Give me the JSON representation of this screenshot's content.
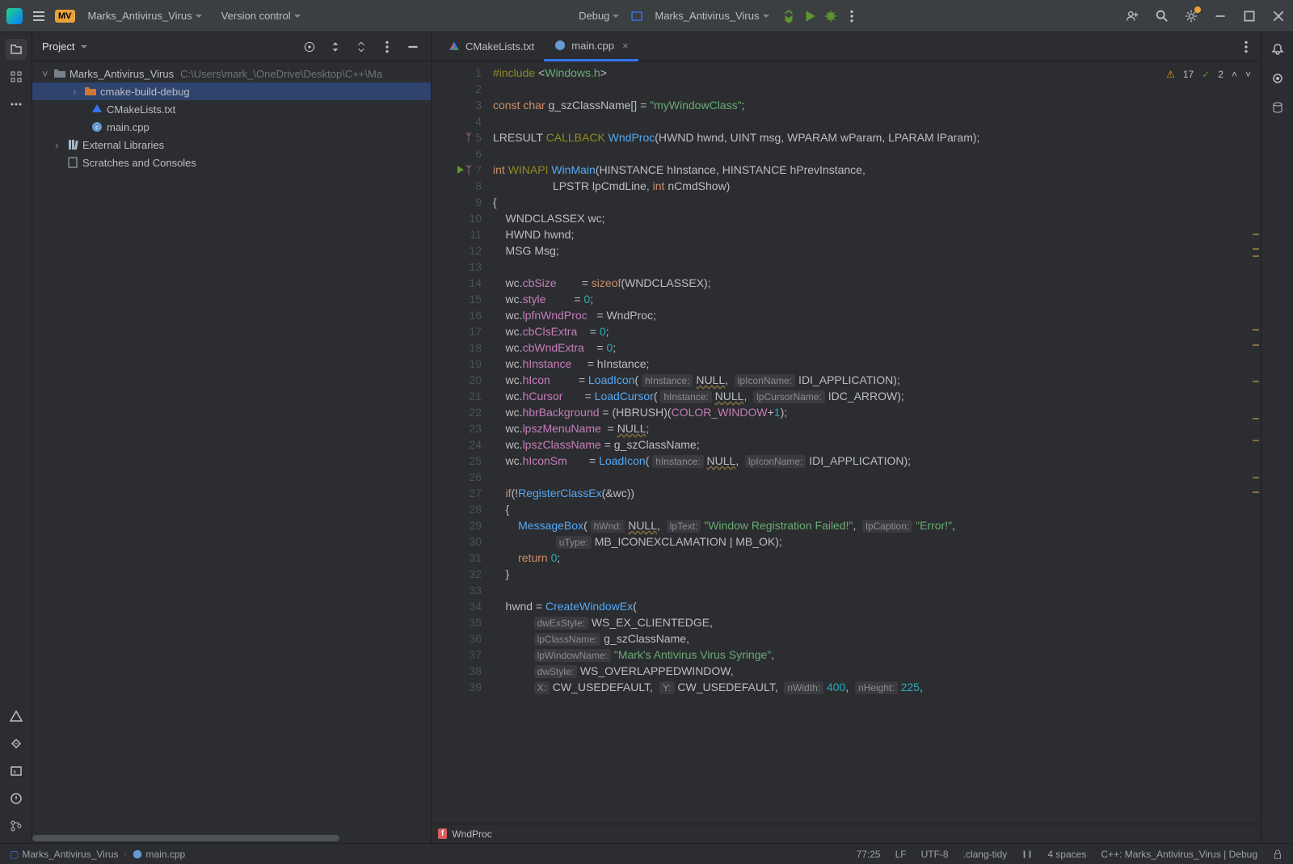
{
  "titlebar": {
    "project_name": "Marks_Antivirus_Virus",
    "project_badge": "MV",
    "vcs": "Version control",
    "run_config": "Debug",
    "target": "Marks_Antivirus_Virus"
  },
  "project_panel": {
    "title": "Project",
    "root": "Marks_Antivirus_Virus",
    "root_path": "C:\\Users\\mark_\\OneDrive\\Desktop\\C++\\Ma",
    "items": [
      {
        "label": "cmake-build-debug",
        "type": "folder"
      },
      {
        "label": "CMakeLists.txt",
        "type": "cmake"
      },
      {
        "label": "main.cpp",
        "type": "cpp"
      }
    ],
    "external": "External Libraries",
    "scratches": "Scratches and Consoles"
  },
  "tabs": [
    {
      "label": "CMakeLists.txt"
    },
    {
      "label": "main.cpp",
      "active": true
    }
  ],
  "inspections": {
    "warnings": "17",
    "weak": "2"
  },
  "breadcrumb": {
    "fn": "WndProc"
  },
  "navbar": {
    "root": "Marks_Antivirus_Virus",
    "file": "main.cpp"
  },
  "status": {
    "pos": "77:25",
    "eol": "LF",
    "enc": "UTF-8",
    "tool": ".clang-tidy",
    "indent": "4 spaces",
    "context": "C++: Marks_Antivirus_Virus | Debug"
  },
  "code_lines": [
    {
      "n": 1,
      "tokens": [
        [
          "macro",
          "#include "
        ],
        [
          "plain",
          "<"
        ],
        [
          "str",
          "Windows.h"
        ],
        [
          "plain",
          ">"
        ]
      ]
    },
    {
      "n": 2,
      "tokens": []
    },
    {
      "n": 3,
      "tokens": [
        [
          "kw",
          "const "
        ],
        [
          "kw",
          "char "
        ],
        [
          "plain",
          "g_szClassName[] = "
        ],
        [
          "str",
          "\"myWindowClass\""
        ],
        [
          "plain",
          ";"
        ]
      ]
    },
    {
      "n": 4,
      "tokens": []
    },
    {
      "n": 5,
      "tokens": [
        [
          "plain",
          "LRESULT "
        ],
        [
          "macro",
          "CALLBACK "
        ],
        [
          "fn",
          "WndProc"
        ],
        [
          "plain",
          "(HWND hwnd, UINT msg, WPARAM wParam, LPARAM lParam);"
        ]
      ]
    },
    {
      "n": 6,
      "tokens": []
    },
    {
      "n": 7,
      "tokens": [
        [
          "kw",
          "int "
        ],
        [
          "macro",
          "WINAPI "
        ],
        [
          "fn",
          "WinMain"
        ],
        [
          "plain",
          "(HINSTANCE hInstance, HINSTANCE hPrevInstance,"
        ]
      ]
    },
    {
      "n": 8,
      "tokens": [
        [
          "plain",
          "                   LPSTR lpCmdLine, "
        ],
        [
          "kw",
          "int "
        ],
        [
          "plain",
          "nCmdShow)"
        ]
      ]
    },
    {
      "n": 9,
      "tokens": [
        [
          "plain",
          "{"
        ]
      ]
    },
    {
      "n": 10,
      "tokens": [
        [
          "plain",
          "    WNDCLASSEX wc;"
        ]
      ]
    },
    {
      "n": 11,
      "tokens": [
        [
          "plain",
          "    HWND hwnd;"
        ]
      ]
    },
    {
      "n": 12,
      "tokens": [
        [
          "plain",
          "    MSG Msg;"
        ]
      ]
    },
    {
      "n": 13,
      "tokens": []
    },
    {
      "n": 14,
      "tokens": [
        [
          "plain",
          "    wc."
        ],
        [
          "fld",
          "cbSize"
        ],
        [
          "plain",
          "        = "
        ],
        [
          "kw",
          "sizeof"
        ],
        [
          "plain",
          "(WNDCLASSEX);"
        ]
      ]
    },
    {
      "n": 15,
      "tokens": [
        [
          "plain",
          "    wc."
        ],
        [
          "fld",
          "style"
        ],
        [
          "plain",
          "         = "
        ],
        [
          "num",
          "0"
        ],
        [
          "plain",
          ";"
        ]
      ]
    },
    {
      "n": 16,
      "tokens": [
        [
          "plain",
          "    wc."
        ],
        [
          "fld",
          "lpfnWndProc"
        ],
        [
          "plain",
          "   = WndProc;"
        ]
      ]
    },
    {
      "n": 17,
      "tokens": [
        [
          "plain",
          "    wc."
        ],
        [
          "fld",
          "cbClsExtra"
        ],
        [
          "plain",
          "    = "
        ],
        [
          "num",
          "0"
        ],
        [
          "plain",
          ";"
        ]
      ]
    },
    {
      "n": 18,
      "tokens": [
        [
          "plain",
          "    wc."
        ],
        [
          "fld",
          "cbWndExtra"
        ],
        [
          "plain",
          "    = "
        ],
        [
          "num",
          "0"
        ],
        [
          "plain",
          ";"
        ]
      ]
    },
    {
      "n": 19,
      "tokens": [
        [
          "plain",
          "    wc."
        ],
        [
          "fld",
          "hInstance"
        ],
        [
          "plain",
          "     = hInstance;"
        ]
      ]
    },
    {
      "n": 20,
      "tokens": [
        [
          "plain",
          "    wc."
        ],
        [
          "fld",
          "hIcon"
        ],
        [
          "plain",
          "         = "
        ],
        [
          "fn",
          "LoadIcon"
        ],
        [
          "plain",
          "( "
        ],
        [
          "hint",
          "hInstance:"
        ],
        [
          "plain",
          " "
        ],
        [
          "wavy",
          "NULL"
        ],
        [
          "plain",
          ",  "
        ],
        [
          "hint",
          "lpIconName:"
        ],
        [
          "plain",
          " IDI_APPLICATION);"
        ]
      ]
    },
    {
      "n": 21,
      "tokens": [
        [
          "plain",
          "    wc."
        ],
        [
          "fld",
          "hCursor"
        ],
        [
          "plain",
          "       = "
        ],
        [
          "fn",
          "LoadCursor"
        ],
        [
          "plain",
          "( "
        ],
        [
          "hint",
          "hInstance:"
        ],
        [
          "plain",
          " "
        ],
        [
          "wavy",
          "NULL"
        ],
        [
          "plain",
          ",  "
        ],
        [
          "hint",
          "lpCursorName:"
        ],
        [
          "plain",
          " IDC_ARROW);"
        ]
      ]
    },
    {
      "n": 22,
      "tokens": [
        [
          "plain",
          "    wc."
        ],
        [
          "fld",
          "hbrBackground"
        ],
        [
          "plain",
          " = (HBRUSH)("
        ],
        [
          "fld",
          "COLOR_WINDOW"
        ],
        [
          "plain",
          "+"
        ],
        [
          "num",
          "1"
        ],
        [
          "plain",
          ");"
        ]
      ]
    },
    {
      "n": 23,
      "tokens": [
        [
          "plain",
          "    wc."
        ],
        [
          "fld",
          "lpszMenuName"
        ],
        [
          "plain",
          "  = "
        ],
        [
          "wavy",
          "NULL"
        ],
        [
          "plain",
          ";"
        ]
      ]
    },
    {
      "n": 24,
      "tokens": [
        [
          "plain",
          "    wc."
        ],
        [
          "fld",
          "lpszClassName"
        ],
        [
          "plain",
          " = g_szClassName;"
        ]
      ]
    },
    {
      "n": 25,
      "tokens": [
        [
          "plain",
          "    wc."
        ],
        [
          "fld",
          "hIconSm"
        ],
        [
          "plain",
          "       = "
        ],
        [
          "fn",
          "LoadIcon"
        ],
        [
          "plain",
          "( "
        ],
        [
          "hint",
          "hInstance:"
        ],
        [
          "plain",
          " "
        ],
        [
          "wavy",
          "NULL"
        ],
        [
          "plain",
          ",  "
        ],
        [
          "hint",
          "lpIconName:"
        ],
        [
          "plain",
          " IDI_APPLICATION);"
        ]
      ]
    },
    {
      "n": 26,
      "tokens": []
    },
    {
      "n": 27,
      "tokens": [
        [
          "plain",
          "    "
        ],
        [
          "kw",
          "if"
        ],
        [
          "plain",
          "(!"
        ],
        [
          "fn",
          "RegisterClassEx"
        ],
        [
          "plain",
          "(&wc))"
        ]
      ]
    },
    {
      "n": 28,
      "tokens": [
        [
          "plain",
          "    {"
        ]
      ]
    },
    {
      "n": 29,
      "tokens": [
        [
          "plain",
          "        "
        ],
        [
          "fn",
          "MessageBox"
        ],
        [
          "plain",
          "( "
        ],
        [
          "hint",
          "hWnd:"
        ],
        [
          "plain",
          " "
        ],
        [
          "wavy",
          "NULL"
        ],
        [
          "plain",
          ",  "
        ],
        [
          "hint",
          "lpText:"
        ],
        [
          "plain",
          " "
        ],
        [
          "str",
          "\"Window Registration Failed!\""
        ],
        [
          "plain",
          ",  "
        ],
        [
          "hint",
          "lpCaption:"
        ],
        [
          "plain",
          " "
        ],
        [
          "str",
          "\"Error!\""
        ],
        [
          "plain",
          ","
        ]
      ]
    },
    {
      "n": 30,
      "tokens": [
        [
          "plain",
          "                    "
        ],
        [
          "hint",
          "uType:"
        ],
        [
          "plain",
          " MB_ICONEXCLAMATION | MB_OK);"
        ]
      ]
    },
    {
      "n": 31,
      "tokens": [
        [
          "plain",
          "        "
        ],
        [
          "kw",
          "return "
        ],
        [
          "num",
          "0"
        ],
        [
          "plain",
          ";"
        ]
      ]
    },
    {
      "n": 32,
      "tokens": [
        [
          "plain",
          "    }"
        ]
      ]
    },
    {
      "n": 33,
      "tokens": []
    },
    {
      "n": 34,
      "tokens": [
        [
          "plain",
          "    hwnd = "
        ],
        [
          "fn",
          "CreateWindowEx"
        ],
        [
          "plain",
          "("
        ]
      ]
    },
    {
      "n": 35,
      "tokens": [
        [
          "plain",
          "             "
        ],
        [
          "hint",
          "dwExStyle:"
        ],
        [
          "plain",
          " WS_EX_CLIENTEDGE,"
        ]
      ]
    },
    {
      "n": 36,
      "tokens": [
        [
          "plain",
          "             "
        ],
        [
          "hint",
          "lpClassName:"
        ],
        [
          "plain",
          " g_szClassName,"
        ]
      ]
    },
    {
      "n": 37,
      "tokens": [
        [
          "plain",
          "             "
        ],
        [
          "hint",
          "lpWindowName:"
        ],
        [
          "plain",
          " "
        ],
        [
          "str",
          "\"Mark's Antivirus Virus Syringe\""
        ],
        [
          "plain",
          ","
        ]
      ]
    },
    {
      "n": 38,
      "tokens": [
        [
          "plain",
          "             "
        ],
        [
          "hint",
          "dwStyle:"
        ],
        [
          "plain",
          " WS_OVERLAPPEDWINDOW,"
        ]
      ]
    },
    {
      "n": 39,
      "tokens": [
        [
          "plain",
          "             "
        ],
        [
          "hint",
          "X:"
        ],
        [
          "plain",
          " CW_USEDEFAULT,  "
        ],
        [
          "hint",
          "Y:"
        ],
        [
          "plain",
          " CW_USEDEFAULT,  "
        ],
        [
          "hint",
          "nWidth:"
        ],
        [
          "plain",
          " "
        ],
        [
          "num",
          "400"
        ],
        [
          "plain",
          ",  "
        ],
        [
          "hint",
          "nHeight:"
        ],
        [
          "plain",
          " "
        ],
        [
          "num",
          "225"
        ],
        [
          "plain",
          ","
        ]
      ]
    }
  ]
}
